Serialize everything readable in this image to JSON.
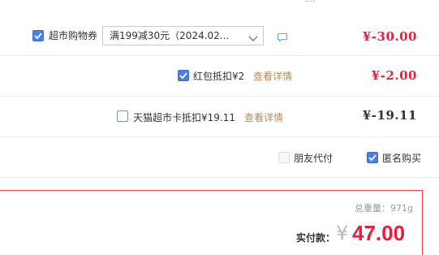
{
  "coupon_row": {
    "label": "超市购物券",
    "selected_option": "满199减30元（2024.02...",
    "amount": "¥-30.00",
    "checked": true
  },
  "redpacket_row": {
    "label": "红包抵扣¥2",
    "details_link": "查看详情",
    "amount": "¥-2.00",
    "checked": true
  },
  "tmall_card_row": {
    "label": "天猫超市卡抵扣¥19.11",
    "details_link": "查看详情",
    "amount": "¥-19.11",
    "checked": false
  },
  "options_row": {
    "friend_pay_label": "朋友代付",
    "friend_pay_checked": false,
    "anonymous_label": "匿名购买",
    "anonymous_checked": true
  },
  "summary": {
    "weight_label": "总重量：",
    "weight_value": "971g",
    "pay_label": "实付款：",
    "currency": "¥",
    "total": "47.00"
  },
  "colors": {
    "accent_red": "#ec1c3c",
    "checkbox_blue": "#4a7de8",
    "link_brown": "#b38a5c"
  }
}
